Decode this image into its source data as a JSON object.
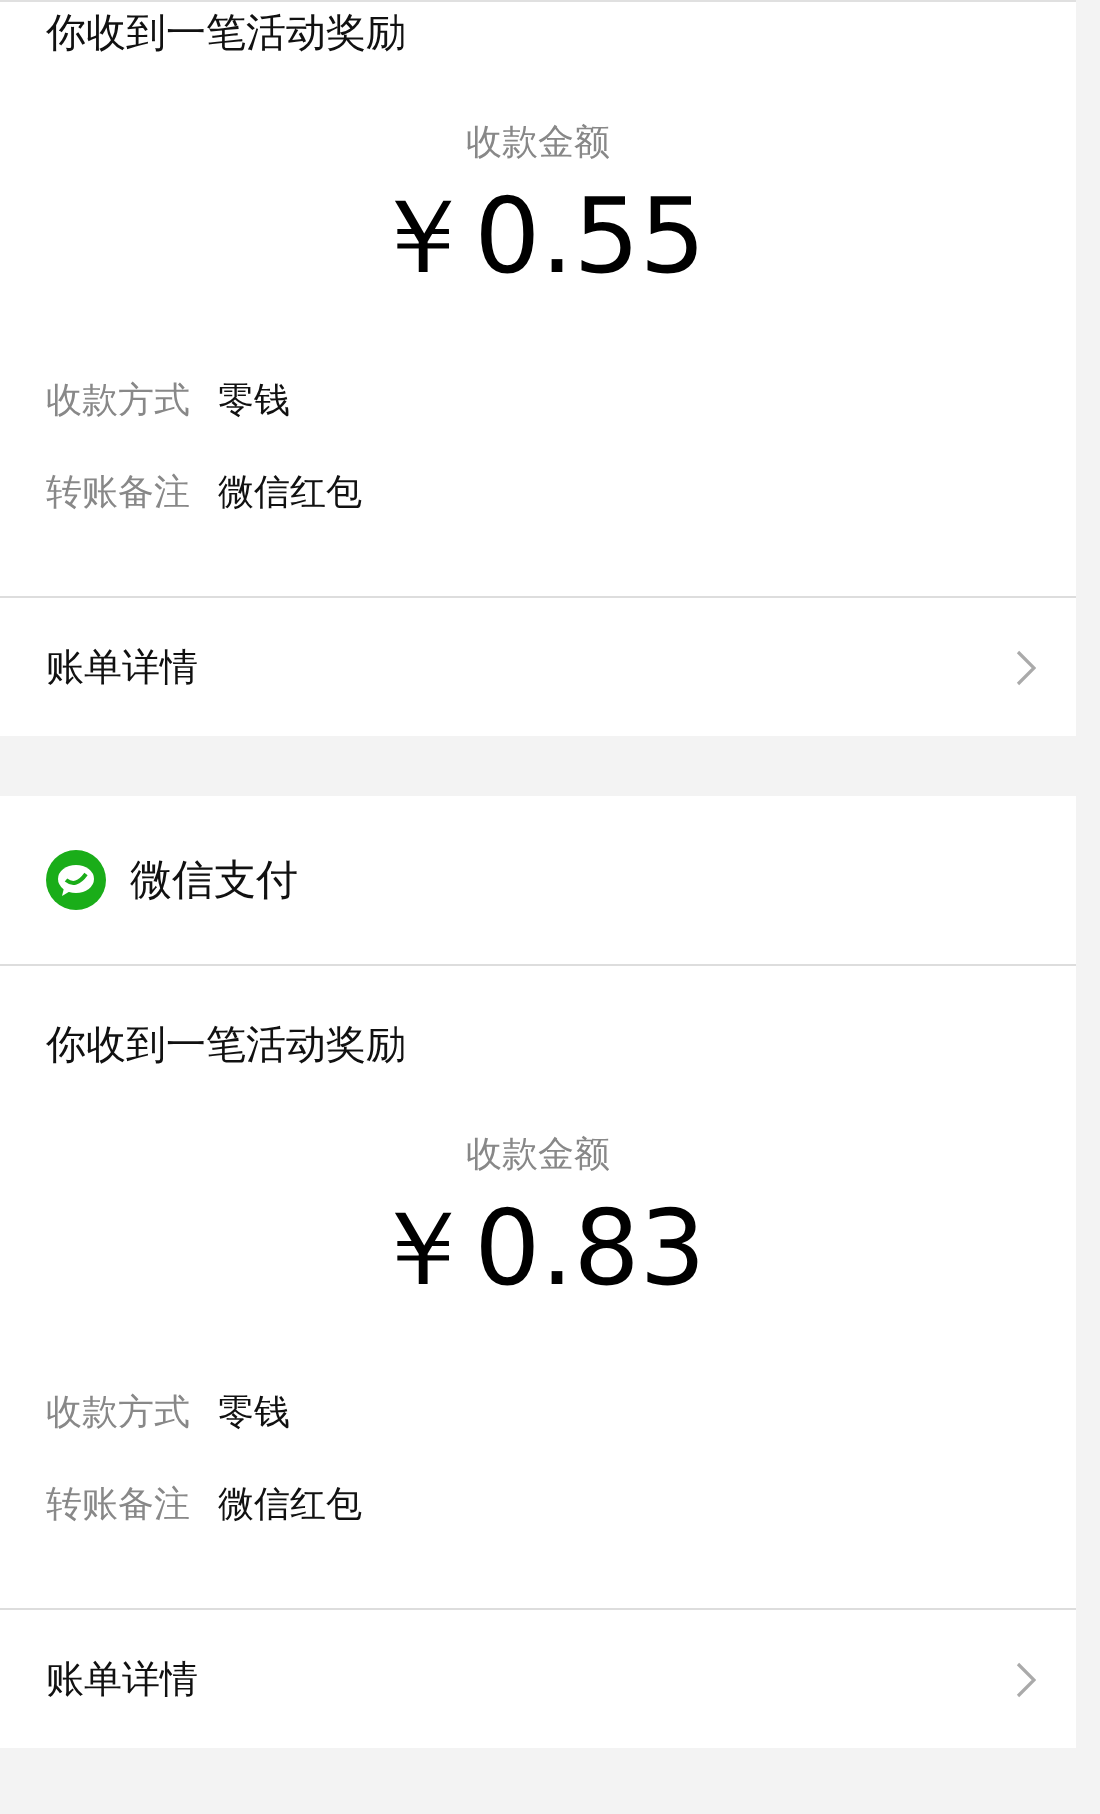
{
  "cards": [
    {
      "title": "你收到一笔活动奖励",
      "amount_label": "收款金额",
      "amount": "￥0.55",
      "details": [
        {
          "label": "收款方式",
          "value": "零钱"
        },
        {
          "label": "转账备注",
          "value": "微信红包"
        }
      ],
      "link": "账单详情"
    },
    {
      "header": "微信支付",
      "title": "你收到一笔活动奖励",
      "amount_label": "收款金额",
      "amount": "￥0.83",
      "details": [
        {
          "label": "收款方式",
          "value": "零钱"
        },
        {
          "label": "转账备注",
          "value": "微信红包"
        }
      ],
      "link": "账单详情"
    }
  ]
}
